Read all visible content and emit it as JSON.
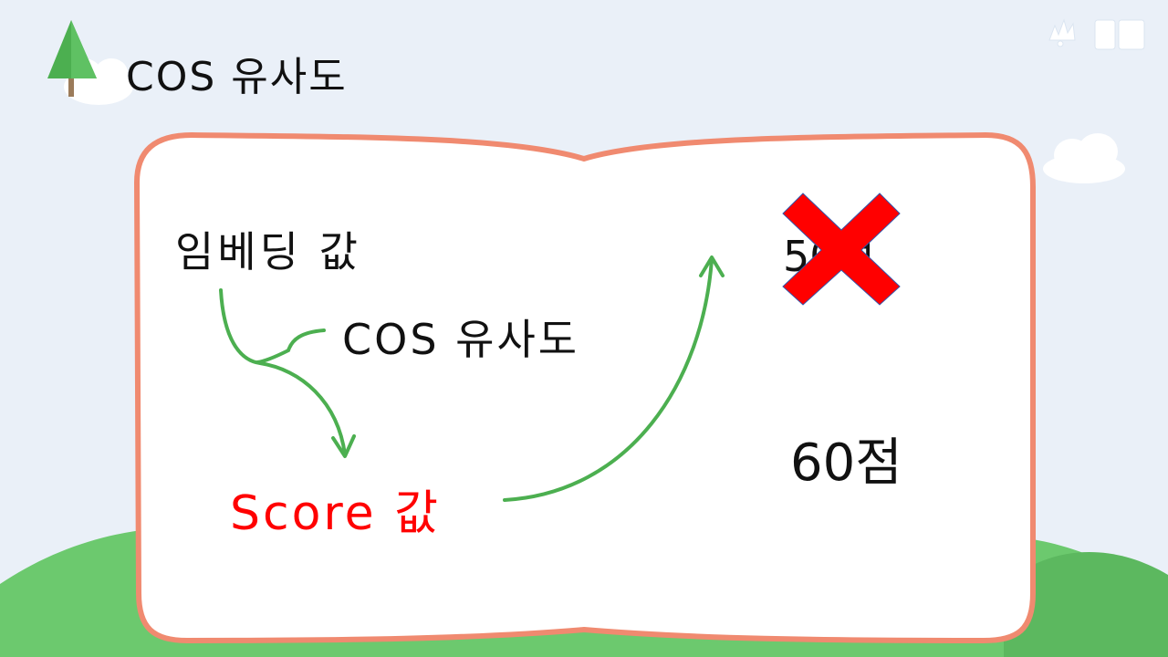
{
  "slide": {
    "title": "COS 유사도",
    "embedding_label": "임베딩 값",
    "cos_label": "COS 유사도",
    "score_label": "Score 값",
    "wrong_score": "50점",
    "right_score": "60점"
  },
  "colors": {
    "background": "#eaf0f8",
    "book_border": "#f08a70",
    "arrow": "#4caf50",
    "score_text": "#ff0000",
    "cross": "#ff0000",
    "hill": "#6cc96e",
    "tree": "#4caf50"
  },
  "icons": {
    "title_icon": "tree-icon",
    "logo": "brand-logo",
    "cross": "x-mark-icon"
  }
}
